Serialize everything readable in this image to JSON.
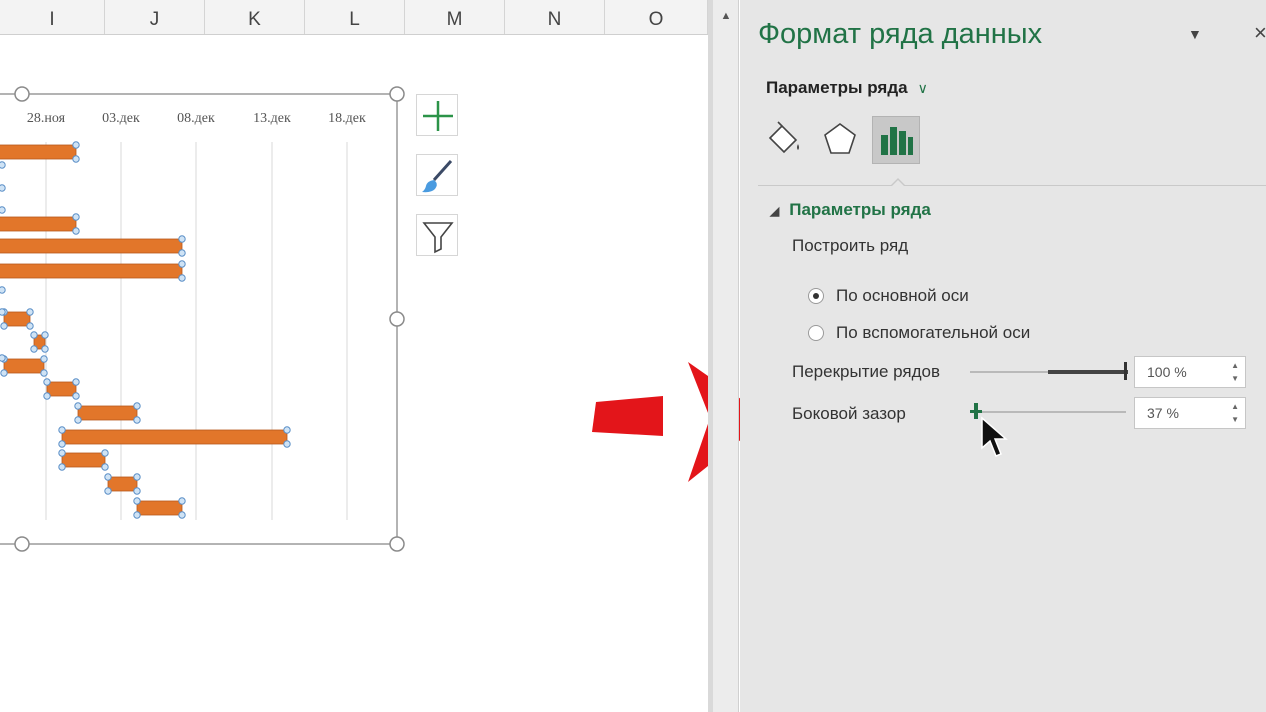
{
  "spreadsheet": {
    "columns": [
      "I",
      "J",
      "K",
      "L",
      "M",
      "N",
      "O"
    ]
  },
  "chart_data": {
    "type": "bar",
    "orientation": "horizontal",
    "x_tick_labels": [
      "28.ноя",
      "03.дек",
      "08.дек",
      "13.дек",
      "18.дек"
    ],
    "series": [
      {
        "color": "#e2762a"
      }
    ],
    "grid": true
  },
  "chart_tools": {
    "add_element_icon": "plus-icon",
    "styles_icon": "brush-icon",
    "filter_icon": "funnel-icon"
  },
  "format_pane": {
    "title": "Формат ряда данных",
    "dropdown_label": "Параметры ряда",
    "section_title": "Параметры ряда",
    "plot_on_label": "Построить ряд",
    "radio_primary": "По основной оси",
    "radio_secondary": "По вспомогательной оси",
    "overlap_label": "Перекрытие рядов",
    "overlap_value": "100 %",
    "overlap_fraction": 1.0,
    "gap_label": "Боковой зазор",
    "gap_value": "37 %",
    "gap_fraction": 0.037,
    "accent": "#217346"
  },
  "annotation": {
    "arrow_color": "#e3151a"
  }
}
